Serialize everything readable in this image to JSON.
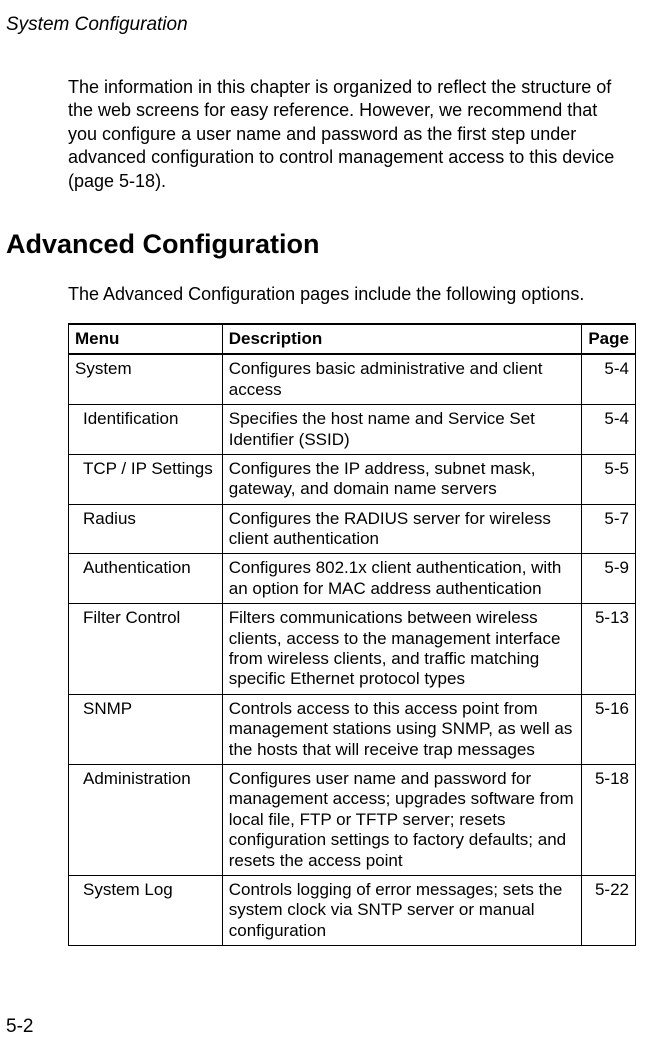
{
  "header": {
    "title": "System Configuration"
  },
  "intro": "The information in this chapter is organized to reflect the structure of the web screens for easy reference. However, we recommend that you configure a user name and password as the first step under advanced configuration to control management access to this device (page 5-18).",
  "section": {
    "heading": "Advanced Configuration",
    "intro": "The Advanced Configuration pages include the following options."
  },
  "table": {
    "headers": {
      "menu": "Menu",
      "description": "Description",
      "page": "Page"
    },
    "rows": [
      {
        "menu": "System",
        "indent": false,
        "description": "Configures basic administrative and client access",
        "page": "5-4"
      },
      {
        "menu": "Identification",
        "indent": true,
        "description": "Specifies the host name and Service Set Identifier (SSID)",
        "page": "5-4"
      },
      {
        "menu": "TCP / IP Settings",
        "indent": true,
        "description": "Configures the IP address, subnet mask, gateway, and domain name servers",
        "page": "5-5"
      },
      {
        "menu": "Radius",
        "indent": true,
        "description": "Configures the RADIUS server for wireless client authentication",
        "page": "5-7"
      },
      {
        "menu": "Authentication",
        "indent": true,
        "description": "Configures 802.1x client authentication, with an option for MAC address authentication",
        "page": "5-9"
      },
      {
        "menu": "Filter Control",
        "indent": true,
        "description": "Filters communications between wireless clients, access to the management interface from wireless clients, and traffic matching specific Ethernet protocol types",
        "page": "5-13"
      },
      {
        "menu": "SNMP",
        "indent": true,
        "description": "Controls access to this access point from management stations using SNMP, as well as the hosts that will receive trap messages",
        "page": "5-16"
      },
      {
        "menu": "Administration",
        "indent": true,
        "description": "Configures user name and password for management access; upgrades software from local file, FTP or TFTP server; resets configuration settings to factory defaults; and resets the access point",
        "page": "5-18"
      },
      {
        "menu": "System Log",
        "indent": true,
        "description": "Controls logging of error messages; sets the system clock via SNTP server or manual configuration",
        "page": "5-22"
      }
    ]
  },
  "pageNumber": "5-2"
}
